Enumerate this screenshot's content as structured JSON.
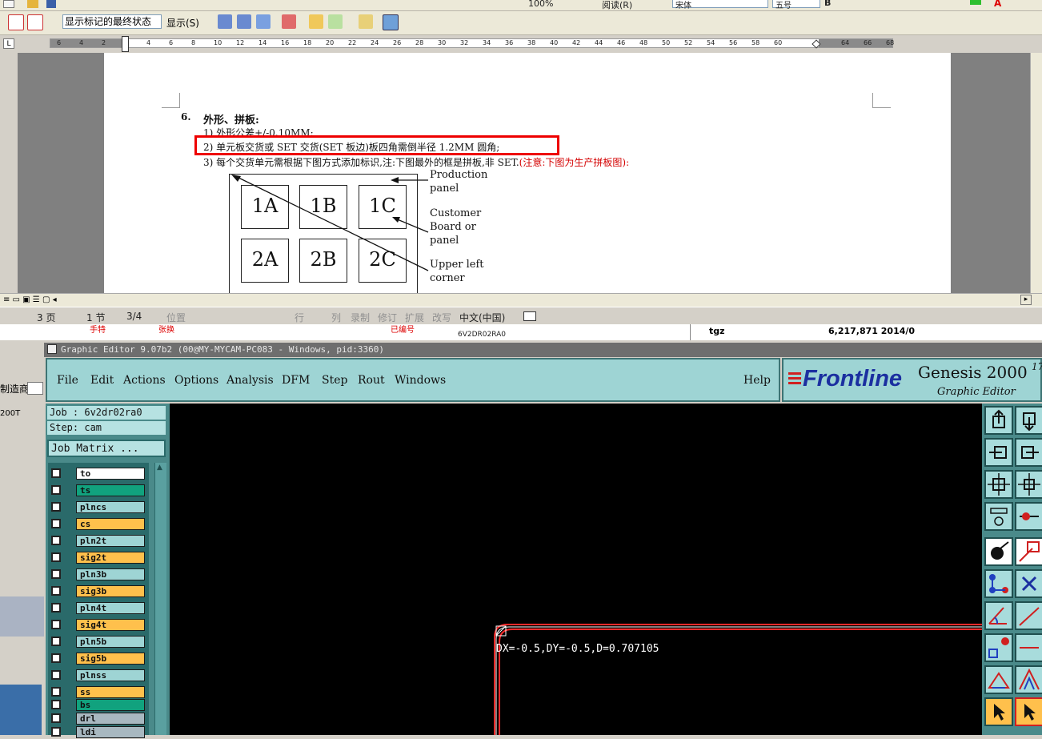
{
  "word": {
    "toolbar1": {
      "zoom": "100%",
      "reading": "阅读(R)",
      "font": "宋体",
      "size": "五号"
    },
    "toolbar2": {
      "markup_state": "显示标记的最终状态",
      "show": "显示(S)"
    },
    "ruler_numbers": [
      "6",
      "4",
      "2",
      "2",
      "4",
      "6",
      "8",
      "10",
      "12",
      "14",
      "16",
      "18",
      "20",
      "22",
      "24",
      "26",
      "28",
      "30",
      "32",
      "34",
      "36",
      "38",
      "40",
      "42",
      "44",
      "46",
      "48",
      "50",
      "52",
      "54",
      "56",
      "58",
      "60",
      "64",
      "66",
      "68"
    ],
    "doc": {
      "heading_num": "6.",
      "heading": "外形、拼板:",
      "item1": "1) 外形公差+/-0.10MM;",
      "item2": "2) 单元板交货或 SET 交货(SET 板边)板四角需倒半径 1.2MM 圆角;",
      "item3_black": "3) 每个交货单元需根据下图方式添加标识,注:下图最外的框是拼板,非 SET.",
      "item3_red": "(注意:下图为生产拼板图):",
      "figure": {
        "cells": [
          "1A",
          "1B",
          "1C",
          "2A",
          "2B",
          "2C"
        ],
        "labels": {
          "production": "Production panel",
          "customer": "Customer Board or panel",
          "upperleft": "Upper left corner"
        }
      }
    },
    "status": {
      "page": "3 页",
      "section": "1 节",
      "pages": "3/4",
      "position": "位置",
      "line": "行",
      "col": "列",
      "rec": "录制",
      "rev": "修订",
      "ext": "扩展",
      "ovr": "改写",
      "lang": "中文(中国)"
    }
  },
  "behind": {
    "tgz": "tgz",
    "size": "6,217,871 2014/0",
    "col_a": "手特",
    "col_b": "张换",
    "col_c": "已编号",
    "col_d": "6V2DR02RA0",
    "left_label": "制造商",
    "left_val": "200T"
  },
  "genesis": {
    "title": "Graphic Editor 9.07b2 (00@MY-MYCAM-PC083 - Windows, pid:3360)",
    "menu": [
      "File",
      "Edit",
      "Actions",
      "Options",
      "Analysis",
      "DFM",
      "Step",
      "Rout",
      "Windows"
    ],
    "help": "Help",
    "logo_brand": "Frontline",
    "logo_product": "Genesis 2000",
    "logo_version": "17",
    "logo_sub": "Graphic Editor",
    "job_label": "Job : 6v2dr02ra0",
    "step_label": "Step: cam",
    "job_matrix": "Job Matrix ...",
    "layers": [
      {
        "name": "to",
        "color": "#ffffff",
        "highlight": true
      },
      {
        "name": "ts",
        "color": "#11a27e"
      },
      {
        "name": "plncs",
        "color": "#9ed4d4"
      },
      {
        "name": "cs",
        "color": "#ffc04c"
      },
      {
        "name": "pln2t",
        "color": "#9ed4d4"
      },
      {
        "name": "sig2t",
        "color": "#ffc04c"
      },
      {
        "name": "pln3b",
        "color": "#9ed4d4"
      },
      {
        "name": "sig3b",
        "color": "#ffc04c"
      },
      {
        "name": "pln4t",
        "color": "#9ed4d4"
      },
      {
        "name": "sig4t",
        "color": "#ffc04c"
      },
      {
        "name": "pln5b",
        "color": "#9ed4d4"
      },
      {
        "name": "sig5b",
        "color": "#ffc04c"
      },
      {
        "name": "plnss",
        "color": "#9ed4d4"
      },
      {
        "name": "ss",
        "color": "#ffc04c"
      },
      {
        "name": "bs",
        "color": "#11a27e"
      },
      {
        "name": "drl",
        "color": "#a8b8c0"
      },
      {
        "name": "ldi",
        "color": "#a8b8c0"
      }
    ],
    "readout": "DX=-0.5,DY=-0.5,D=0.707105"
  }
}
